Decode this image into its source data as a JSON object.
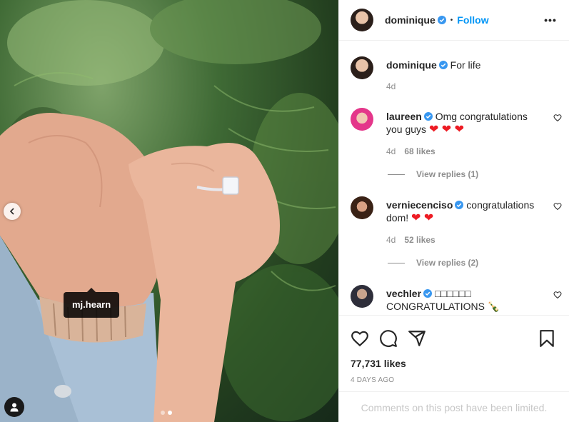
{
  "post": {
    "author": "dominique",
    "follow_label": "Follow",
    "separator": "•",
    "more_label": "•••",
    "caption": "For life",
    "caption_time": "4d",
    "photo_tag": "mj.hearn"
  },
  "comments": [
    {
      "user": "laureen",
      "text": "Omg congratulations you guys",
      "emoji": "❤ ❤ ❤",
      "time": "4d",
      "likes": "68 likes",
      "replies": "View replies (1)"
    },
    {
      "user": "verniecenciso",
      "text": "congratulations dom!",
      "emoji": "❤ ❤",
      "time": "4d",
      "likes": "52 likes",
      "replies": "View replies (2)"
    },
    {
      "user": "vechler",
      "text": "□□□□□□",
      "text2": "CONGRATULATIONS 🍾"
    }
  ],
  "footer": {
    "like_count": "77,731 likes",
    "date": "4 DAYS AGO",
    "limited_notice": "Comments on this post have been limited."
  },
  "colors": {
    "accent": "#0095f6",
    "verified": "#3897f0",
    "heart": "#ed1c24"
  },
  "carousel": {
    "slides": 2,
    "active": 2
  }
}
